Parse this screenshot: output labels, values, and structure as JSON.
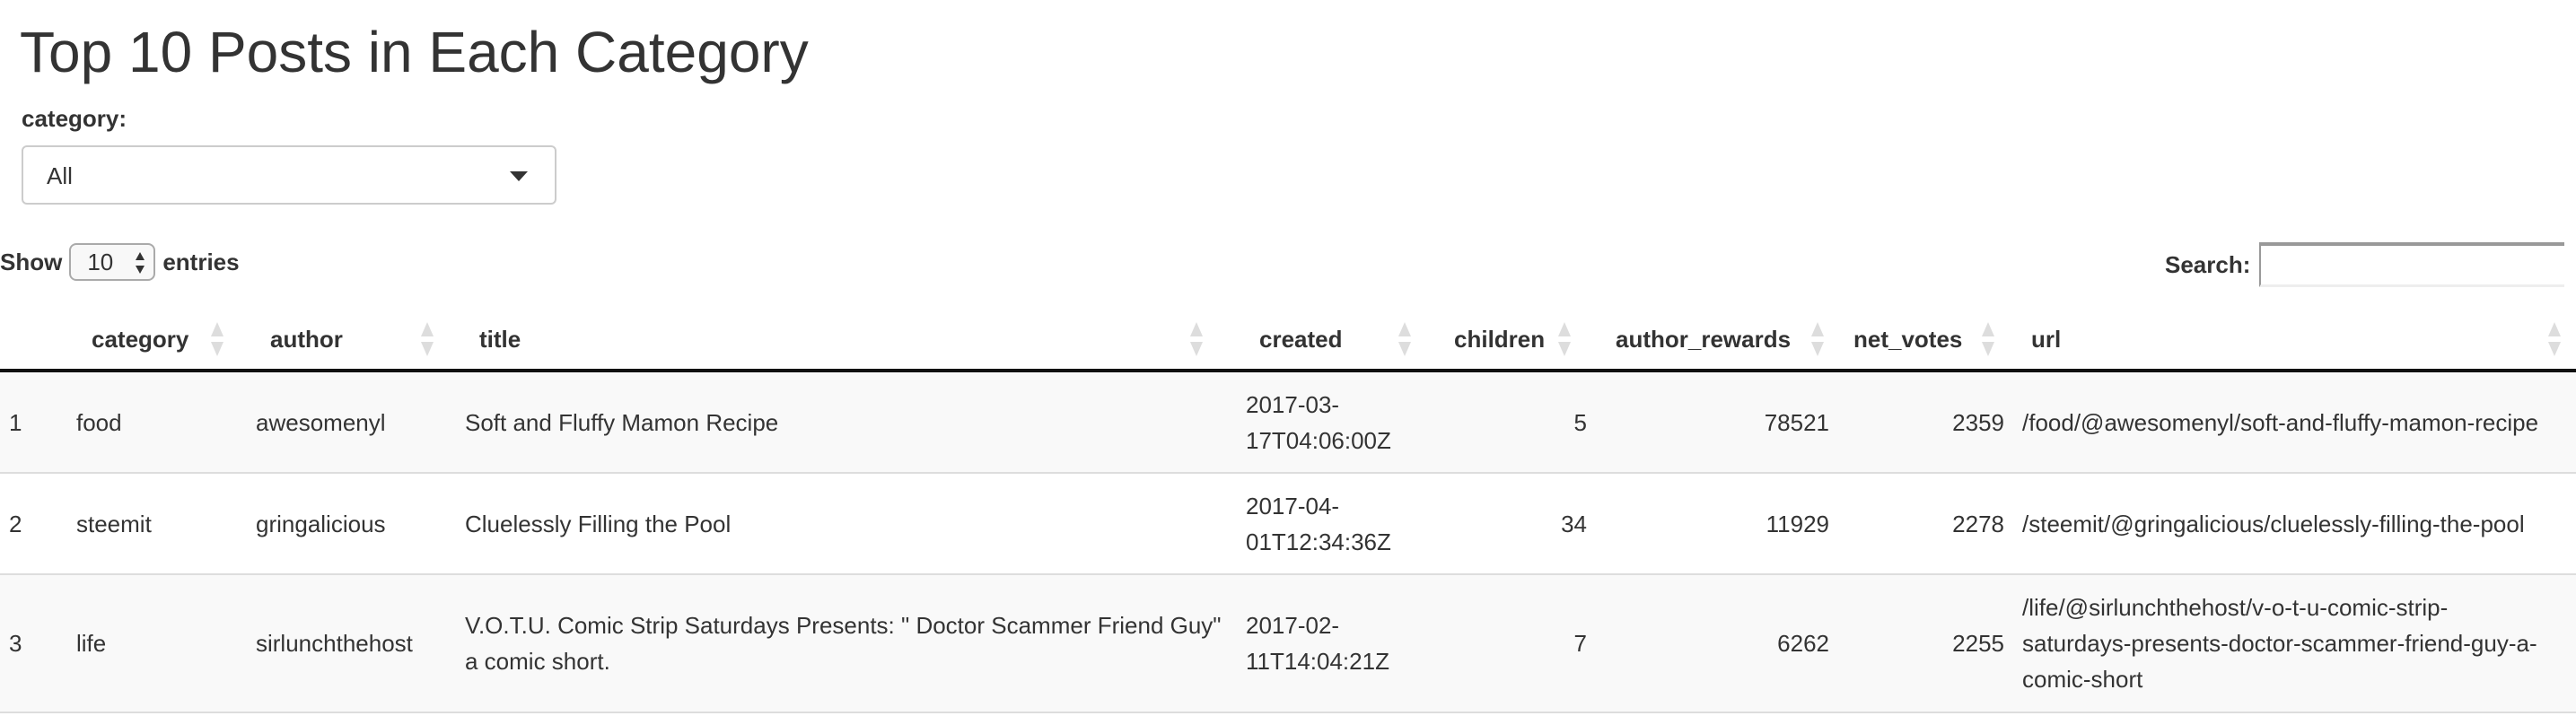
{
  "page": {
    "title": "Top 10 Posts in Each Category"
  },
  "filter": {
    "label": "category:",
    "selected": "All"
  },
  "length_control": {
    "prefix": "Show",
    "value": "10",
    "suffix": "entries"
  },
  "search": {
    "label": "Search:",
    "value": ""
  },
  "table": {
    "columns": [
      "",
      "category",
      "author",
      "title",
      "created",
      "children",
      "author_rewards",
      "net_votes",
      "url"
    ],
    "rows": [
      {
        "index": "1",
        "category": "food",
        "author": "awesomenyl",
        "title": "Soft and Fluffy Mamon Recipe",
        "created": "2017-03-17T04:06:00Z",
        "children": "5",
        "author_rewards": "78521",
        "net_votes": "2359",
        "url": "/food/@awesomenyl/soft-and-fluffy-mamon-recipe"
      },
      {
        "index": "2",
        "category": "steemit",
        "author": "gringalicious",
        "title": "Cluelessly Filling the Pool",
        "created": "2017-04-01T12:34:36Z",
        "children": "34",
        "author_rewards": "11929",
        "net_votes": "2278",
        "url": "/steemit/@gringalicious/cluelessly-filling-the-pool"
      },
      {
        "index": "3",
        "category": "life",
        "author": "sirlunchthehost",
        "title": "V.O.T.U. Comic Strip Saturdays Presents: \" Doctor Scammer Friend Guy\" a comic short.",
        "created": "2017-02-11T14:04:21Z",
        "children": "7",
        "author_rewards": "6262",
        "net_votes": "2255",
        "url": "/life/@sirlunchthehost/v-o-t-u-comic-strip-saturdays-presents-doctor-scammer-friend-guy-a-comic-short"
      }
    ]
  }
}
